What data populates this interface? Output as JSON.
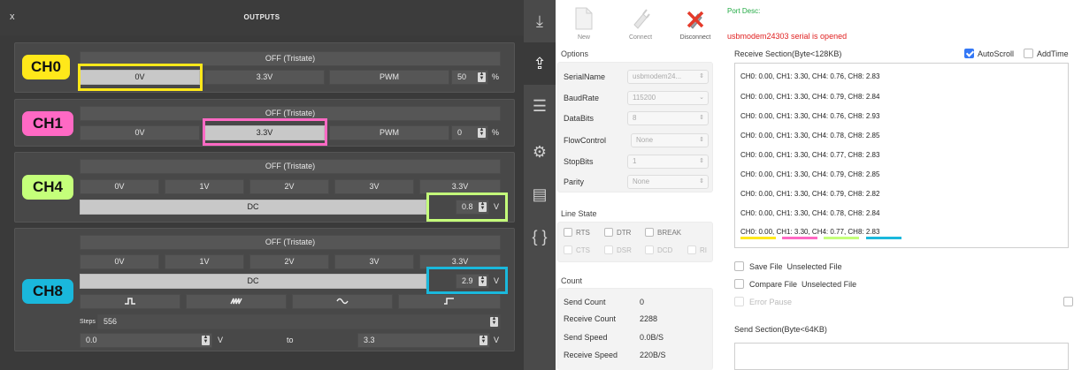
{
  "outputs": {
    "title": "OUTPUTS",
    "close": "x",
    "channels": {
      "ch0": {
        "tag": "CH0",
        "color": "#ffe81a",
        "tristate": "OFF (Tristate)",
        "btn_0v": "0V",
        "btn_33v": "3.3V",
        "btn_pwm": "PWM",
        "pwm_value": "50",
        "pwm_unit": "%"
      },
      "ch1": {
        "tag": "CH1",
        "color": "#ff69c4",
        "tristate": "OFF (Tristate)",
        "btn_0v": "0V",
        "btn_33v": "3.3V",
        "btn_pwm": "PWM",
        "pwm_value": "0",
        "pwm_unit": "%"
      },
      "ch4": {
        "tag": "CH4",
        "color": "#c4ff7a",
        "tristate": "OFF (Tristate)",
        "btns": [
          "0V",
          "1V",
          "2V",
          "3V",
          "3.3V"
        ],
        "dc": "DC",
        "dc_value": "0.8",
        "dc_unit": "V"
      },
      "ch8": {
        "tag": "CH8",
        "color": "#1ab8dc",
        "tristate": "OFF (Tristate)",
        "btns": [
          "0V",
          "1V",
          "2V",
          "3V",
          "3.3V"
        ],
        "dc": "DC",
        "dc_value": "2.9",
        "dc_unit": "V",
        "waves": [
          "square-wave-icon",
          "sawtooth-wave-icon",
          "sine-wave-icon",
          "pulse-wave-icon"
        ],
        "steps_label": "Steps",
        "steps_value": "556",
        "from_value": "0.0",
        "from_unit": "V",
        "to_label": "to",
        "to_value": "3.3",
        "to_unit": "V"
      }
    }
  },
  "sidebar": {
    "items": [
      {
        "name": "download-tray-icon",
        "glyph": "⤓"
      },
      {
        "name": "upload-tray-icon",
        "glyph": "⇪"
      },
      {
        "name": "list-icon",
        "glyph": "☰"
      },
      {
        "name": "gear-icon",
        "glyph": "⚙"
      },
      {
        "name": "clipboard-icon",
        "glyph": "▤"
      },
      {
        "name": "braces-icon",
        "glyph": "{ }"
      }
    ]
  },
  "serial": {
    "toolbar": {
      "new": "New",
      "connect": "Connect",
      "disconnect": "Disconnect"
    },
    "port_desc": "Port Desc:",
    "port_status": "usbmodem24303 serial is opened",
    "options_title": "Options",
    "options": [
      {
        "label": "SerialName",
        "value": "usbmodem24...",
        "arrow": "⇕"
      },
      {
        "label": "BaudRate",
        "value": "115200",
        "arrow": "⌄"
      },
      {
        "label": "DataBits",
        "value": "8",
        "arrow": "⇕"
      },
      {
        "label": "FlowControl",
        "value": "None",
        "arrow": "⇕"
      },
      {
        "label": "StopBits",
        "value": "1",
        "arrow": "⇕"
      },
      {
        "label": "Parity",
        "value": "None",
        "arrow": "⇕"
      }
    ],
    "line_state_title": "Line State",
    "line_state": {
      "rts": "RTS",
      "dtr": "DTR",
      "brk": "BREAK",
      "cts": "CTS",
      "dsr": "DSR",
      "dcd": "DCD",
      "ri": "RI"
    },
    "count_title": "Count",
    "counts": [
      {
        "label": "Send Count",
        "value": "0"
      },
      {
        "label": "Receive Count",
        "value": "2288"
      },
      {
        "label": "Send Speed",
        "value": "0.0B/S"
      },
      {
        "label": "Receive Speed",
        "value": "220B/S"
      }
    ],
    "receive_title": "Receive Section(Byte<128KB)",
    "autoscroll": "AutoScroll",
    "addtime": "AddTime",
    "lines": [
      "CH0: 0.00, CH1: 3.30, CH4: 0.76, CH8: 2.83",
      "CH0: 0.00, CH1: 3.30, CH4: 0.79, CH8: 2.84",
      "CH0: 0.00, CH1: 3.30, CH4: 0.76, CH8: 2.93",
      "CH0: 0.00, CH1: 3.30, CH4: 0.78, CH8: 2.85",
      "CH0: 0.00, CH1: 3.30, CH4: 0.77, CH8: 2.83",
      "CH0: 0.00, CH1: 3.30, CH4: 0.79, CH8: 2.85",
      "CH0: 0.00, CH1: 3.30, CH4: 0.79, CH8: 2.82",
      "CH0: 0.00, CH1: 3.30, CH4: 0.78, CH8: 2.84",
      "CH0: 0.00, CH1: 3.30, CH4: 0.77, CH8: 2.83"
    ],
    "save_file": "Save File",
    "save_file_state": "Unselected File",
    "compare_file": "Compare File",
    "compare_file_state": "Unselected File",
    "error_pause": "Error Pause",
    "send_title": "Send Section(Byte<64KB)"
  }
}
